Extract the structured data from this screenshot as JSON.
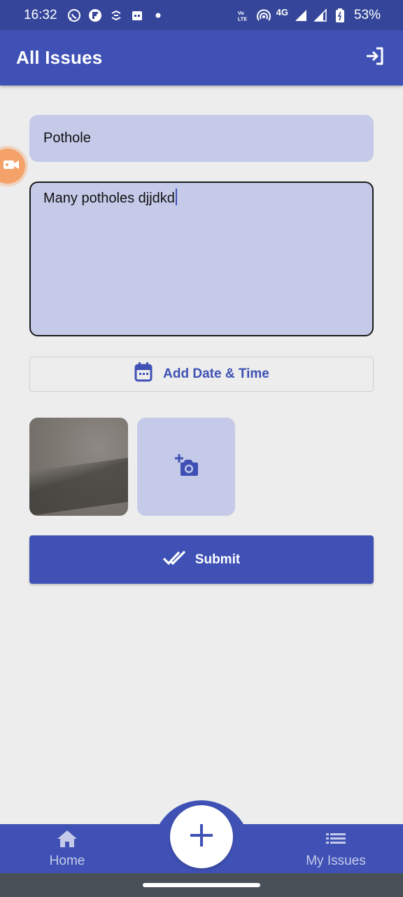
{
  "status_bar": {
    "time": "16:32",
    "battery": "53%",
    "network": "4G",
    "left_icons": [
      "whatsapp-icon",
      "flipboard-icon",
      "sync-icon",
      "calendar-app-icon",
      "notification-dot-icon"
    ],
    "right_icons": [
      "volte-icon",
      "hotspot-icon",
      "signal-icon",
      "signal-icon-2",
      "battery-icon"
    ]
  },
  "app_bar": {
    "title": "All Issues",
    "action_icon": "logout-icon"
  },
  "form": {
    "title_value": "Pothole",
    "description_value": "Many potholes djjdkd",
    "date_button_label": "Add Date & Time",
    "submit_label": "Submit"
  },
  "bottom_nav": {
    "home_label": "Home",
    "issues_label": "My Issues",
    "fab_icon": "plus-icon"
  },
  "colors": {
    "primary": "#3f51b5",
    "status_bar": "#35469a",
    "field_bg": "#c5cae9",
    "background": "#ededed"
  }
}
